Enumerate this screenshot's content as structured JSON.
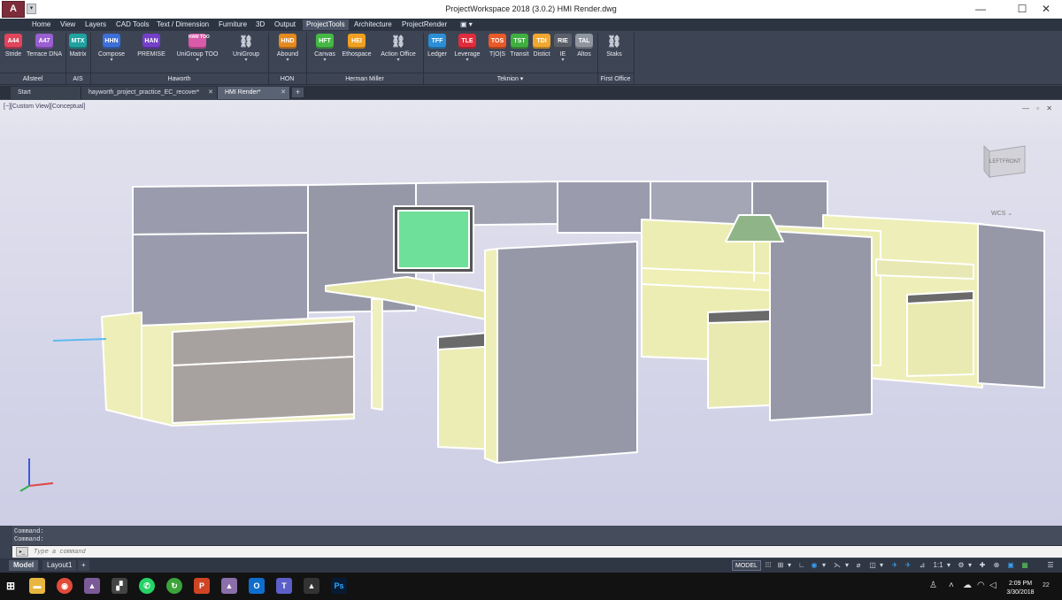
{
  "titlebar": {
    "title": "ProjectWorkspace 2018 (3.0.2)    HMI Render.dwg",
    "app_button": "A",
    "quick_access": "▾",
    "minimize": "—",
    "maximize": "☐",
    "close": "✕"
  },
  "menu": {
    "items": [
      "Home",
      "View",
      "Layers",
      "CAD Tools",
      "Text / Dimension",
      "Furniture",
      "3D",
      "Output",
      "ProjectTools",
      "Architecture",
      "ProjectRender",
      "▣ ▾"
    ],
    "active": "ProjectTools"
  },
  "ribbon": {
    "buttons": [
      {
        "icon": "A44",
        "label": "Stride",
        "color": "#e0455c"
      },
      {
        "icon": "A47",
        "label": "Terrace DNA",
        "color": "#9a5fd0"
      },
      {
        "icon": "MTX",
        "label": "Matrix",
        "color": "#20a3a0"
      },
      {
        "icon": "HHN",
        "label": "Compose",
        "color": "#3c6fd8",
        "dropdown": "▾"
      },
      {
        "icon": "HAN",
        "label": "PREMISE",
        "color": "#7440c8"
      },
      {
        "icon": "HAW TOO",
        "label": "UniGroup TOO",
        "color": "#d85aa8",
        "dropdown": "▾"
      },
      {
        "icon": "⛓",
        "label": "UniGroup",
        "color": "#3d4555",
        "dropdown": "▾"
      },
      {
        "icon": "HND",
        "label": "Abound",
        "color": "#e48a20",
        "dropdown": "▾"
      },
      {
        "icon": "HFT",
        "label": "Canvas",
        "color": "#46b845",
        "dropdown": "▾"
      },
      {
        "icon": "HEI",
        "label": "Ethospace",
        "color": "#f0a020"
      },
      {
        "icon": "⛓",
        "label": "Action Office",
        "color": "#3d4555",
        "dropdown": "▾"
      },
      {
        "icon": "TFF",
        "label": "Ledger",
        "color": "#2b8fd6"
      },
      {
        "icon": "TLE",
        "label": "Leverage",
        "color": "#e02c3c",
        "dropdown": "▾"
      },
      {
        "icon": "TOS",
        "label": "T|O|S",
        "color": "#e85a2a"
      },
      {
        "icon": "TST",
        "label": "Transit",
        "color": "#40b040"
      },
      {
        "icon": "TDI",
        "label": "Distict",
        "color": "#f0a830"
      },
      {
        "icon": "RIE",
        "label": "IE",
        "color": "#5a5f69",
        "dropdown": "▾"
      },
      {
        "icon": "TAL",
        "label": "Altos",
        "color": "#9096a0"
      },
      {
        "icon": "⛓",
        "label": "Staks",
        "color": "#3d4555"
      }
    ],
    "panels": [
      "Allsteel",
      "AIS",
      "Haworth",
      "HON",
      "Herman Miller",
      "Teknion ▾",
      "First Office"
    ]
  },
  "tabs": [
    {
      "label": "Start"
    },
    {
      "label": "hayworth_project_practice_EC_recover*",
      "close": "✕"
    },
    {
      "label": "HMI Render*",
      "close": "✕"
    }
  ],
  "tab_plus": "+",
  "viewport": {
    "label": "[−][Custom View][Conceptual]",
    "controls": "— ▫ ✕",
    "viewcube": {
      "left": "LEFT",
      "front": "FRONT"
    },
    "wcs": "WCS ⌄",
    "background_color": "#dcdcea"
  },
  "command": {
    "history": [
      "Command:",
      "Command:"
    ],
    "placeholder": "Type a command",
    "prompt_icon": "▸_"
  },
  "layouts": {
    "tabs": [
      "Model",
      "Layout1"
    ],
    "add": "+",
    "active": "Model"
  },
  "statusbar": {
    "model": "MODEL",
    "icons": [
      "⁞⁞⁞",
      "⊞",
      "▾",
      "∟",
      "◉",
      "▾",
      "⋋",
      "▾",
      "⌀",
      "◫",
      "▾",
      "✈",
      "✈",
      "⊿",
      "1:1",
      "▾",
      "⚙",
      "▾",
      "✚",
      "⊕",
      "▣",
      "▦",
      "☰"
    ]
  },
  "taskbar": {
    "apps": [
      {
        "name": "windows-start",
        "glyph": "⊞",
        "color": "#121212"
      },
      {
        "name": "file-explorer",
        "glyph": "▬",
        "color": "#e8b640"
      },
      {
        "name": "chrome",
        "glyph": "◉",
        "color": "#e14b3a"
      },
      {
        "name": "cad-app",
        "glyph": "▲",
        "color": "#7a5b98"
      },
      {
        "name": "cad-app-2",
        "glyph": "▞",
        "color": "#444"
      },
      {
        "name": "whatsapp",
        "glyph": "✆",
        "color": "#25d366"
      },
      {
        "name": "refresh-app",
        "glyph": "↻",
        "color": "#3aa33a"
      },
      {
        "name": "powerpoint",
        "glyph": "P",
        "color": "#d04423"
      },
      {
        "name": "cad-app-3",
        "glyph": "▲",
        "color": "#8a6faa"
      },
      {
        "name": "outlook",
        "glyph": "O",
        "color": "#0f6ecd"
      },
      {
        "name": "teams",
        "glyph": "T",
        "color": "#5b5fc7"
      },
      {
        "name": "photos",
        "glyph": "▲",
        "color": "#333"
      },
      {
        "name": "photoshop",
        "glyph": "Ps",
        "color": "#071b33"
      }
    ],
    "time": "2:09 PM",
    "date": "3/30/2018",
    "notifications": "22"
  }
}
